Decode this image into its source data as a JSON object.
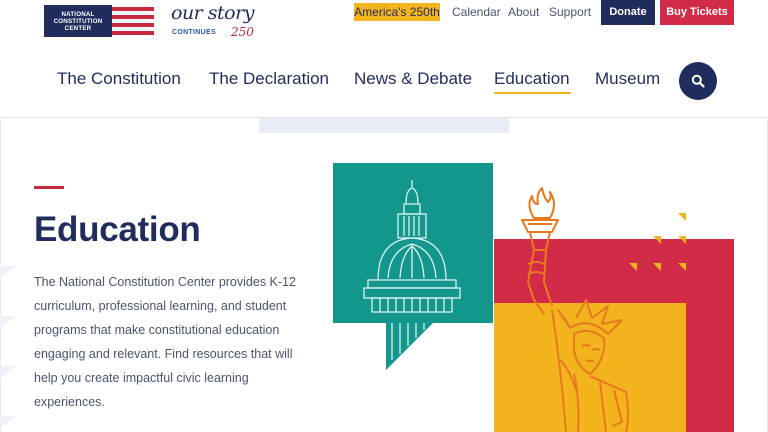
{
  "header": {
    "logo": {
      "line1": "NATIONAL",
      "line2": "CONSTITUTION",
      "line3": "CENTER"
    },
    "campaign": {
      "script": "our story",
      "continues": "CONTINUES",
      "number": "250"
    },
    "utility": {
      "badge": "America's 250th",
      "links": [
        "Calendar",
        "About",
        "Support"
      ],
      "donate": "Donate",
      "tickets": "Buy Tickets"
    },
    "nav": [
      "The Constitution",
      "The Declaration",
      "News & Debate",
      "Education",
      "Museum"
    ],
    "active_nav": "Education",
    "search_icon": "search-icon"
  },
  "hero": {
    "title": "Education",
    "description": "The National Constitution Center provides K-12 curriculum, professional learning, and student programs that make constitutional education engaging and relevant. Find resources that will help you create impactful civic learning experiences."
  },
  "colors": {
    "navy": "#1f2c5c",
    "red": "#c8283c",
    "gold": "#f2b31d",
    "teal": "#13968c",
    "crimson": "#d12b48",
    "orange": "#e8781e"
  }
}
